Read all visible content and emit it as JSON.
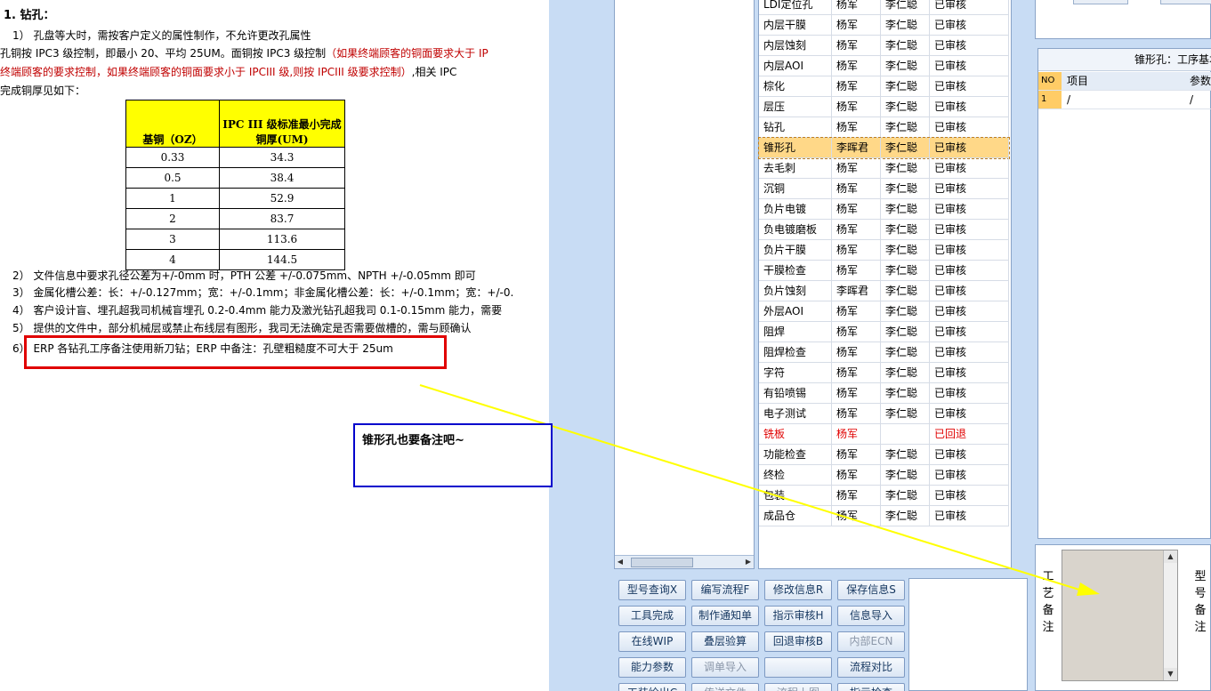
{
  "doc": {
    "heading": "1.  钻孔：",
    "line1": "1）  孔盘等大时，需按客户定义的属性制作，不允许更改孔属性",
    "line2a": "孔铜按 IPC3 级控制，即最小 20、平均 25UM。面铜按 IPC3 级控制",
    "line2b": "（如果终端顾客的铜面要求大于 IP",
    "line3a": "终端顾客的要求控制，如果终端顾客的铜面要求小于 IPCIII 级,则按 IPCIII 级要求控制）",
    "line3b": ",相关 IPC",
    "line4": "完成铜厚见如下：",
    "table": {
      "header1": "基铜（OZ）",
      "header2": "IPC III 级标准最小完成铜厚(UM)",
      "rows": [
        {
          "oz": "0.33",
          "um": "34.3"
        },
        {
          "oz": "0.5",
          "um": "38.4"
        },
        {
          "oz": "1",
          "um": "52.9"
        },
        {
          "oz": "2",
          "um": "83.7"
        },
        {
          "oz": "3",
          "um": "113.6"
        },
        {
          "oz": "4",
          "um": "144.5"
        }
      ]
    },
    "item2": "2）  文件信息中要求孔径公差为+/-0mm 时，PTH 公差 +/-0.075mm、NPTH +/-0.05mm 即可",
    "item3": "3）  金属化槽公差：长：+/-0.127mm；宽：+/-0.1mm；非金属化槽公差：长：+/-0.1mm；宽：+/-0.",
    "item4": "4）  客户设计盲、埋孔超我司机械盲埋孔 0.2-0.4mm 能力及激光钻孔超我司 0.1-0.15mm 能力，需要",
    "item5": "5）  提供的文件中，部分机械层或禁止布线层有图形，我司无法确定是否需要做槽的，需与顾确认",
    "item6": "6）  ERP 各钻孔工序备注使用新刀钻；ERP 中备注：孔壁粗糙度不可大于 25um",
    "callout": "锥形孔也要备注吧~"
  },
  "process_grid": {
    "rows": [
      {
        "process": "LDI定位孔",
        "maker": "杨军",
        "reviewer": "李仁聪",
        "status": "已审核"
      },
      {
        "process": "内层干膜",
        "maker": "杨军",
        "reviewer": "李仁聪",
        "status": "已审核"
      },
      {
        "process": "内层蚀刻",
        "maker": "杨军",
        "reviewer": "李仁聪",
        "status": "已审核"
      },
      {
        "process": "内层AOI",
        "maker": "杨军",
        "reviewer": "李仁聪",
        "status": "已审核"
      },
      {
        "process": "棕化",
        "maker": "杨军",
        "reviewer": "李仁聪",
        "status": "已审核"
      },
      {
        "process": "层压",
        "maker": "杨军",
        "reviewer": "李仁聪",
        "status": "已审核"
      },
      {
        "process": "钻孔",
        "maker": "杨军",
        "reviewer": "李仁聪",
        "status": "已审核"
      },
      {
        "process": "锥形孔",
        "maker": "李晖君",
        "reviewer": "李仁聪",
        "status": "已审核"
      },
      {
        "process": "去毛刺",
        "maker": "杨军",
        "reviewer": "李仁聪",
        "status": "已审核"
      },
      {
        "process": "沉铜",
        "maker": "杨军",
        "reviewer": "李仁聪",
        "status": "已审核"
      },
      {
        "process": "负片电镀",
        "maker": "杨军",
        "reviewer": "李仁聪",
        "status": "已审核"
      },
      {
        "process": "负电镀磨板",
        "maker": "杨军",
        "reviewer": "李仁聪",
        "status": "已审核"
      },
      {
        "process": "负片干膜",
        "maker": "杨军",
        "reviewer": "李仁聪",
        "status": "已审核"
      },
      {
        "process": "干膜检查",
        "maker": "杨军",
        "reviewer": "李仁聪",
        "status": "已审核"
      },
      {
        "process": "负片蚀刻",
        "maker": "李晖君",
        "reviewer": "李仁聪",
        "status": "已审核"
      },
      {
        "process": "外层AOI",
        "maker": "杨军",
        "reviewer": "李仁聪",
        "status": "已审核"
      },
      {
        "process": "阻焊",
        "maker": "杨军",
        "reviewer": "李仁聪",
        "status": "已审核"
      },
      {
        "process": "阻焊检查",
        "maker": "杨军",
        "reviewer": "李仁聪",
        "status": "已审核"
      },
      {
        "process": "字符",
        "maker": "杨军",
        "reviewer": "李仁聪",
        "status": "已审核"
      },
      {
        "process": "有铅喷锡",
        "maker": "杨军",
        "reviewer": "李仁聪",
        "status": "已审核"
      },
      {
        "process": "电子测试",
        "maker": "杨军",
        "reviewer": "李仁聪",
        "status": "已审核"
      },
      {
        "process": "铣板",
        "maker": "杨军",
        "reviewer": "",
        "status": "已回退"
      },
      {
        "process": "功能检查",
        "maker": "杨军",
        "reviewer": "李仁聪",
        "status": "已审核"
      },
      {
        "process": "终检",
        "maker": "杨军",
        "reviewer": "李仁聪",
        "status": "已审核"
      },
      {
        "process": "包装",
        "maker": "杨军",
        "reviewer": "李仁聪",
        "status": "已审核"
      },
      {
        "process": "成品仓",
        "maker": "杨军",
        "reviewer": "李仁聪",
        "status": "已审核"
      }
    ]
  },
  "detail_panel": {
    "title": "锥形孔：工序基本",
    "col_no": "NO",
    "col_item": "项目",
    "col_param": "参数",
    "row_no": "1",
    "row_item": "/",
    "row_param": "/"
  },
  "buttons": {
    "model_query": "型号查询X",
    "write_flow": "编写流程F",
    "modify_info": "修改信息R",
    "save_info": "保存信息S",
    "tool_done": "工具完成",
    "make_notice": "制作通知单",
    "assign_review": "指示审核H",
    "import_info": "信息导入",
    "online_wip": "在线WIP",
    "stack_check": "叠层验算",
    "rollback_review": "回退审核B",
    "internal_ecn": "内部ECN",
    "capability_params": "能力参数",
    "single_import": "调单导入",
    "flow_compare": "流程对比",
    "row5_a": "工装绘出C",
    "row5_b": "传送文件",
    "row5_c": "流程上图",
    "row5_d": "指示检查"
  },
  "remark": {
    "left_label": [
      "工",
      "艺",
      "备",
      "注"
    ],
    "right_label": [
      "型",
      "号",
      "备",
      "注"
    ]
  },
  "colors": {
    "selected_row": "#ffd888",
    "rollback_text": "#e00000",
    "highlight_box": "#e00000",
    "callout_border": "#0000cc",
    "arrow": "#ffff00",
    "table_header": "#ffff00"
  }
}
